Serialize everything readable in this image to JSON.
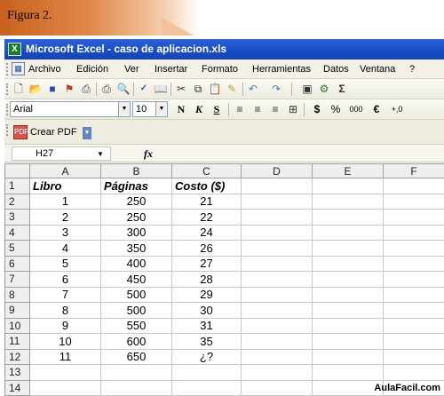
{
  "figure": {
    "label": "Figura 2."
  },
  "window": {
    "title": "Microsoft Excel - caso de aplicacion.xls",
    "app_icon": "excel-icon"
  },
  "menu": {
    "items": [
      "Archivo",
      "Edición",
      "Ver",
      "Insertar",
      "Formato",
      "Herramientas",
      "Datos",
      "Ventana",
      "?"
    ]
  },
  "toolbar_standard": {
    "icons": [
      "new-icon",
      "open-icon",
      "save-icon",
      "permission-icon",
      "print-icon",
      "print-preview-icon",
      "spelling-icon",
      "research-icon",
      "cut-icon",
      "copy-icon",
      "paste-icon",
      "format-painter-icon",
      "undo-icon",
      "redo-icon",
      "insert-hyperlink-icon",
      "pdf-icon",
      "sum-icon"
    ]
  },
  "toolbar_format": {
    "font_name": "Arial",
    "font_size": "10",
    "bold": "N",
    "italic": "K",
    "underline": "S",
    "currency": "$",
    "percent": "%",
    "thousands": "000",
    "euro": "€",
    "increase_decimal": "+,0"
  },
  "toolbar_pdf": {
    "label": "Crear PDF"
  },
  "formula_bar": {
    "name_box": "H27",
    "fx": "fx"
  },
  "grid": {
    "columns": [
      "A",
      "B",
      "C",
      "D",
      "E",
      "F"
    ],
    "rows": [
      {
        "n": "1",
        "cells": [
          "Libro",
          "Páginas",
          "Costo ($)",
          "",
          "",
          ""
        ]
      },
      {
        "n": "2",
        "cells": [
          "1",
          "250",
          "21",
          "",
          "",
          ""
        ]
      },
      {
        "n": "3",
        "cells": [
          "2",
          "250",
          "22",
          "",
          "",
          ""
        ]
      },
      {
        "n": "4",
        "cells": [
          "3",
          "300",
          "24",
          "",
          "",
          ""
        ]
      },
      {
        "n": "5",
        "cells": [
          "4",
          "350",
          "26",
          "",
          "",
          ""
        ]
      },
      {
        "n": "6",
        "cells": [
          "5",
          "400",
          "27",
          "",
          "",
          ""
        ]
      },
      {
        "n": "7",
        "cells": [
          "6",
          "450",
          "28",
          "",
          "",
          ""
        ]
      },
      {
        "n": "8",
        "cells": [
          "7",
          "500",
          "29",
          "",
          "",
          ""
        ]
      },
      {
        "n": "9",
        "cells": [
          "8",
          "500",
          "30",
          "",
          "",
          ""
        ]
      },
      {
        "n": "10",
        "cells": [
          "9",
          "550",
          "31",
          "",
          "",
          ""
        ]
      },
      {
        "n": "11",
        "cells": [
          "10",
          "600",
          "35",
          "",
          "",
          ""
        ]
      },
      {
        "n": "12",
        "cells": [
          "11",
          "650",
          "¿?",
          "",
          "",
          ""
        ]
      },
      {
        "n": "13",
        "cells": [
          "",
          "",
          "",
          "",
          "",
          ""
        ]
      },
      {
        "n": "14",
        "cells": [
          "",
          "",
          "",
          "",
          "",
          ""
        ]
      }
    ]
  },
  "watermark": "AulaFacil.com",
  "colors": {
    "title_bar": "#1a4fc6",
    "banner_orange": "#c8621e"
  }
}
